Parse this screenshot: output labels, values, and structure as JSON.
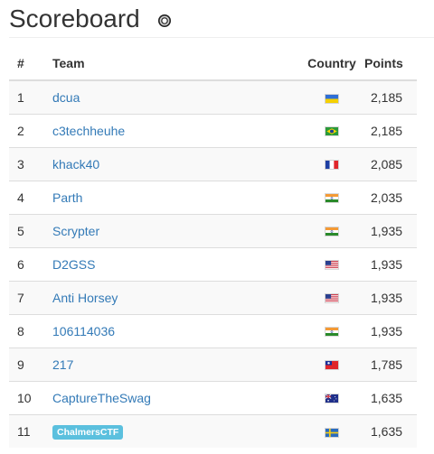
{
  "page": {
    "title": "Scoreboard"
  },
  "table": {
    "headers": {
      "rank": "#",
      "team": "Team",
      "country": "Country",
      "points": "Points"
    },
    "rows": [
      {
        "rank": "1",
        "team": "dcua",
        "country": "ua",
        "points": "2,185",
        "badge": false
      },
      {
        "rank": "2",
        "team": "c3techheuhe",
        "country": "br",
        "points": "2,185",
        "badge": false
      },
      {
        "rank": "3",
        "team": "khack40",
        "country": "fr",
        "points": "2,085",
        "badge": false
      },
      {
        "rank": "4",
        "team": "Parth",
        "country": "in",
        "points": "2,035",
        "badge": false
      },
      {
        "rank": "5",
        "team": "Scrypter",
        "country": "in",
        "points": "1,935",
        "badge": false
      },
      {
        "rank": "6",
        "team": "D2GSS",
        "country": "us",
        "points": "1,935",
        "badge": false
      },
      {
        "rank": "7",
        "team": "Anti Horsey",
        "country": "us",
        "points": "1,935",
        "badge": false
      },
      {
        "rank": "8",
        "team": "106114036",
        "country": "in",
        "points": "1,935",
        "badge": false
      },
      {
        "rank": "9",
        "team": "217",
        "country": "tw",
        "points": "1,785",
        "badge": false
      },
      {
        "rank": "10",
        "team": "CaptureTheSwag",
        "country": "au",
        "points": "1,635",
        "badge": false
      },
      {
        "rank": "11",
        "team": "ChalmersCTF",
        "country": "se",
        "points": "1,635",
        "badge": true
      }
    ]
  },
  "colors": {
    "link": "#337ab7",
    "badge": "#5bc0de",
    "stripe": "#f9f9f9"
  }
}
